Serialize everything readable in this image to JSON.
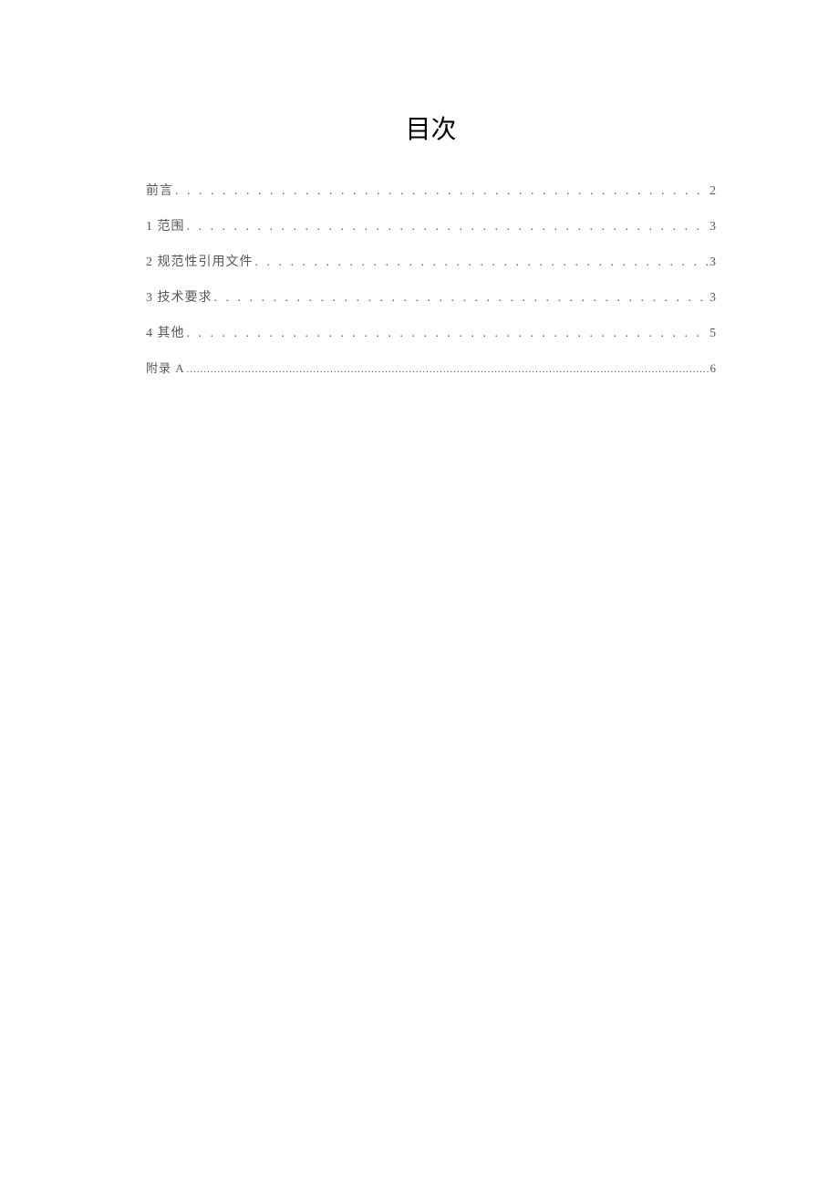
{
  "title": "目次",
  "toc": [
    {
      "label": "前言",
      "page": "2",
      "style": "normal"
    },
    {
      "label": "1 范围",
      "page": "3",
      "style": "normal"
    },
    {
      "label": "2 规范性引用文件",
      "page": "3",
      "style": "normal"
    },
    {
      "label": "3 技术要求",
      "page": "3",
      "style": "normal"
    },
    {
      "label": "4 其他",
      "page": "5",
      "style": "normal"
    },
    {
      "label": "附录 A",
      "page": "6",
      "style": "small-dots"
    }
  ]
}
